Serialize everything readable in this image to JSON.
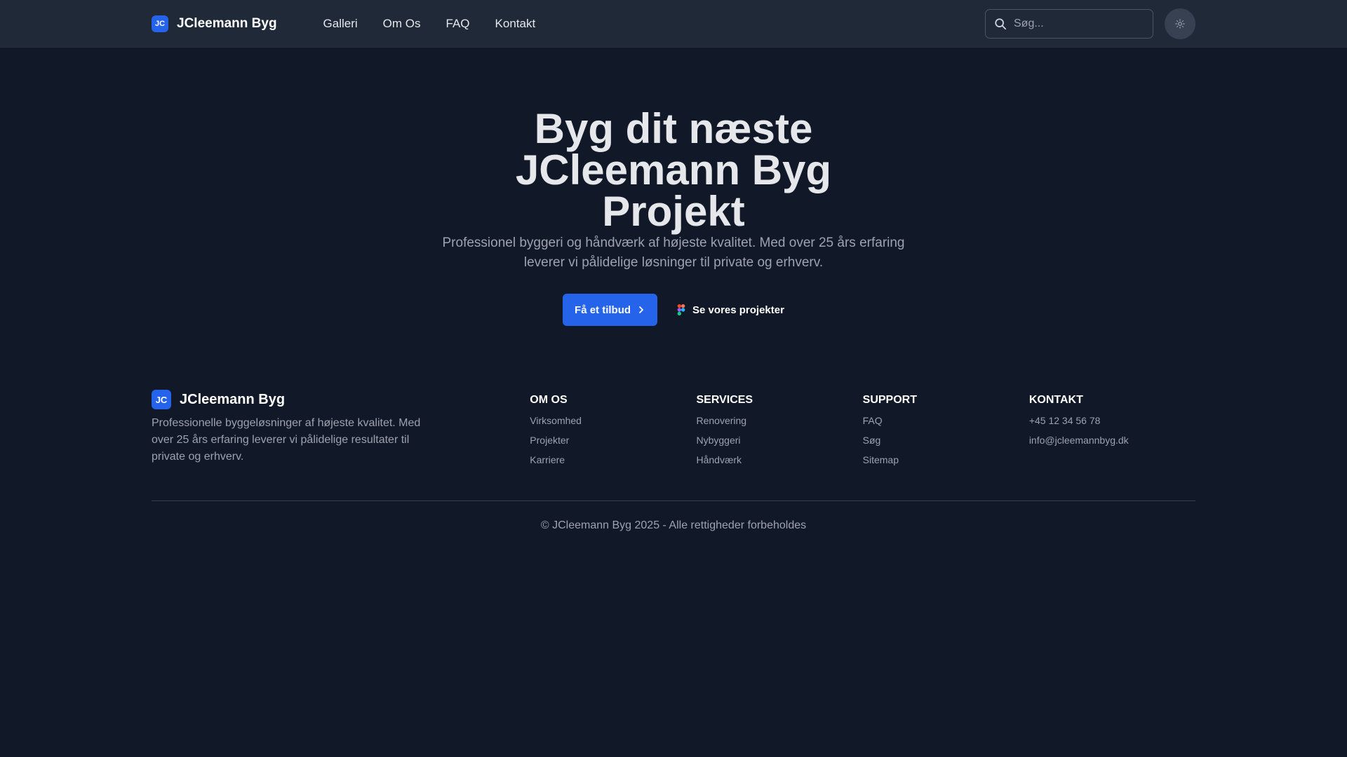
{
  "navbar": {
    "logo_initials": "JC",
    "brand_name": "JCleemann Byg",
    "links": [
      "Galleri",
      "Om Os",
      "FAQ",
      "Kontakt"
    ],
    "search_placeholder": "Søg...",
    "theme_toggle_icon": "sun-icon"
  },
  "hero": {
    "title": "Byg dit næste JCleemann Byg Projekt",
    "subtitle": "Professionel byggeri og håndværk af højeste kvalitet. Med over 25 års erfaring leverer vi pålidelige løsninger til private og erhverv.",
    "primary_button": "Få et tilbud",
    "secondary_button": "Se vores projekter"
  },
  "footer": {
    "logo_initials": "JC",
    "brand_name": "JCleemann Byg",
    "description": "Professionelle byggeløsninger af højeste kvalitet. Med over 25 års erfaring leverer vi pålidelige resultater til private og erhverv.",
    "columns": [
      {
        "title": "OM OS",
        "items": [
          "Virksomhed",
          "Projekter",
          "Karriere"
        ]
      },
      {
        "title": "SERVICES",
        "items": [
          "Renovering",
          "Nybyggeri",
          "Håndværk"
        ]
      },
      {
        "title": "SUPPORT",
        "items": [
          "FAQ",
          "Søg",
          "Sitemap"
        ]
      },
      {
        "title": "KONTAKT",
        "items": [
          "+45 12 34 56 78",
          "info@jcleemannbyg.dk"
        ]
      }
    ],
    "copyright": "© JCleemann Byg 2025 - Alle rettigheder forbeholdes"
  },
  "colors": {
    "background": "#111827",
    "navbar": "#1f2937",
    "accent": "#2563eb",
    "muted_text": "#9ca3af"
  }
}
